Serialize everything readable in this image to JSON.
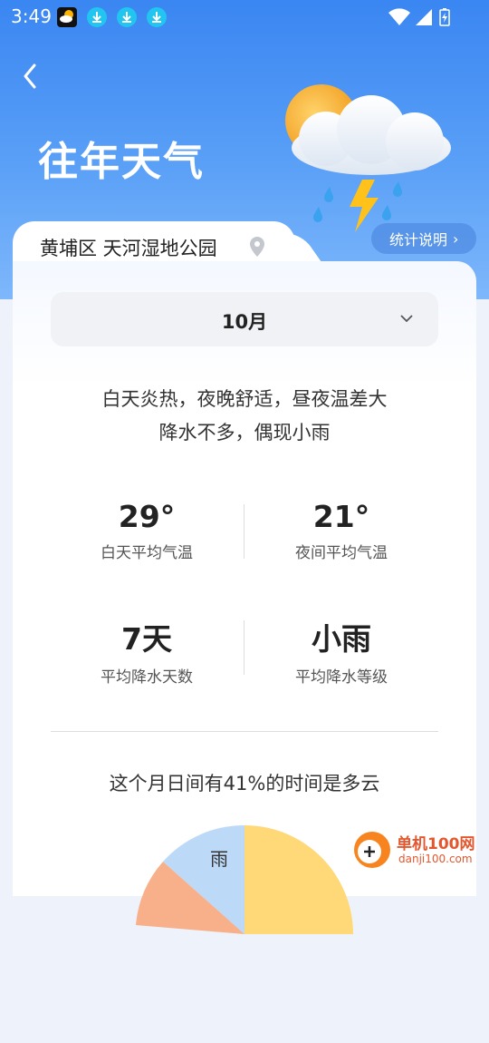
{
  "status": {
    "time": "3:49"
  },
  "header": {
    "title": "往年天气"
  },
  "location": {
    "name": "黄埔区 天河湿地公园"
  },
  "stats_button": {
    "label": "统计说明"
  },
  "month_selector": {
    "value": "10月"
  },
  "description": {
    "line1": "白天炎热，夜晚舒适，昼夜温差大",
    "line2": "降水不多，偶现小雨"
  },
  "metrics": [
    {
      "value": "29°",
      "label": "白天平均气温"
    },
    {
      "value": "21°",
      "label": "夜间平均气温"
    },
    {
      "value": "7天",
      "label": "平均降水天数"
    },
    {
      "value": "小雨",
      "label": "平均降水等级"
    }
  ],
  "cloud_summary": "这个月日间有41%的时间是多云",
  "pie": {
    "slices": [
      {
        "label": "雨",
        "color": "#bcdaf8"
      },
      {
        "label": "",
        "color": "#ffd978"
      }
    ]
  },
  "watermark": {
    "brand": "单机100网",
    "url": "danji100.com"
  },
  "colors": {
    "header_top": "#3a86f2",
    "header_bottom": "#7eb7fb"
  }
}
